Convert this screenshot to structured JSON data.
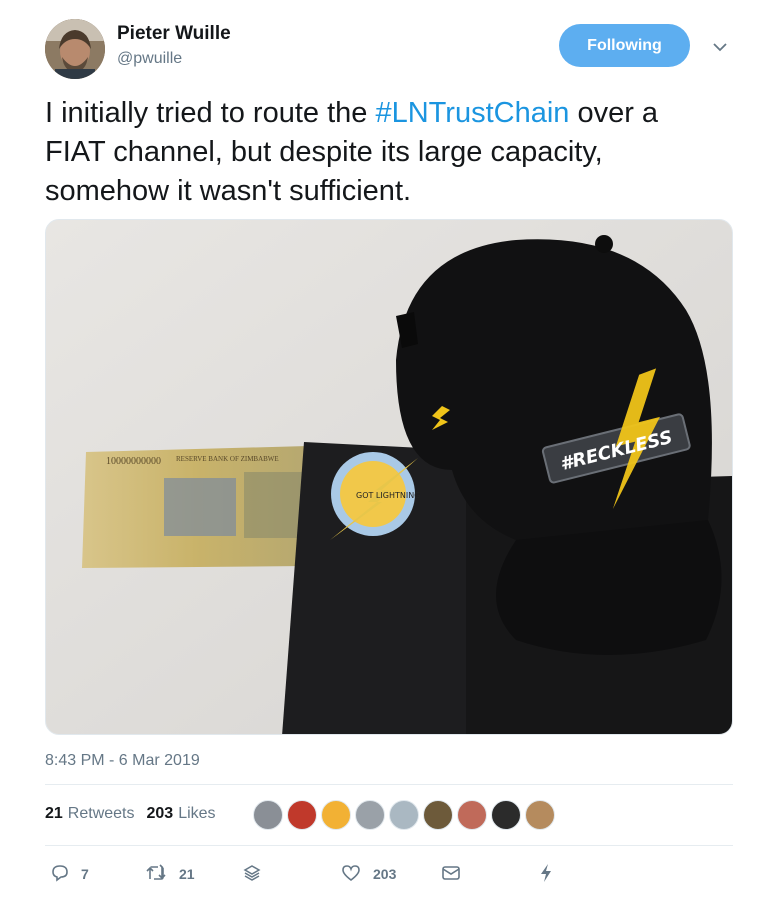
{
  "author": {
    "name": "Pieter Wuille",
    "handle": "@pwuille"
  },
  "follow_button": {
    "label": "Following",
    "color": "#5daef0"
  },
  "tweet": {
    "text_before": "I initially tried to route the ",
    "hashtag": "#LNTrustChain",
    "text_after": " over a FIAT channel, but despite its large capacity, somehow it wasn't sufficient.",
    "hashtag_color": "#1b95e0"
  },
  "photo": {
    "banknote_number": "10000000000",
    "banknote_issuer": "RESERVE BANK OF ZIMBABWE",
    "hat_patch": "#RECKLESS",
    "sticker_text": "GOT LIGHTNING"
  },
  "timestamp": "8:43 PM - 6 Mar 2019",
  "stats": {
    "retweets_count": "21",
    "retweets_label": "Retweets",
    "likes_count": "203",
    "likes_label": "Likes"
  },
  "likers": [
    "#8a8f96",
    "#c0392b",
    "#f2b134",
    "#9aa1a8",
    "#aab8c2",
    "#6d5a3a",
    "#c06a5a",
    "#2b2b2b",
    "#b58b5e"
  ],
  "actions": {
    "reply_count": "7",
    "retweet_count": "21",
    "like_count": "203"
  },
  "icons": [
    "reply-icon",
    "retweet-icon",
    "stack-icon",
    "heart-icon",
    "mail-icon",
    "bolt-icon",
    "chevron-down-icon"
  ]
}
